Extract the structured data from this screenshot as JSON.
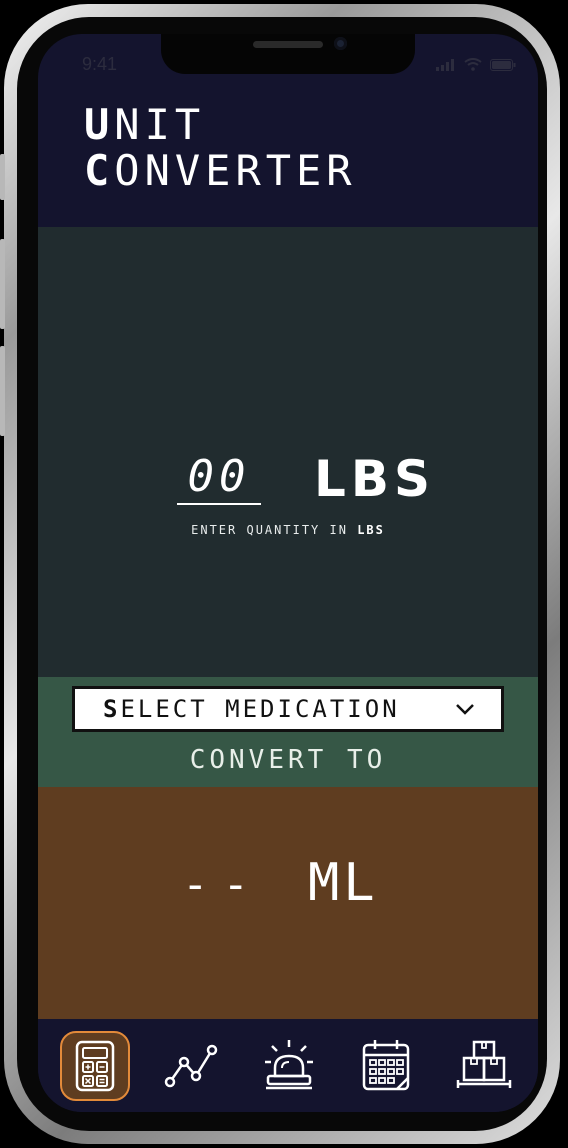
{
  "status_bar": {
    "time": "9:41"
  },
  "header": {
    "title_line1_first": "U",
    "title_line1_rest": "NIT",
    "title_line2_first": "C",
    "title_line2_rest": "ONVERTER"
  },
  "input": {
    "quantity": "00",
    "unit": "LBS",
    "hint_prefix": "ENTER QUANTITY IN",
    "hint_unit": "LBS"
  },
  "select": {
    "label_first": "S",
    "label_rest": "ELECT MEDICATION"
  },
  "convert_label": "CONVERT TO",
  "result": {
    "value": "--",
    "unit": "ML"
  },
  "tabs": [
    {
      "icon": "calculator-icon",
      "active": true
    },
    {
      "icon": "line-chart-icon",
      "active": false
    },
    {
      "icon": "siren-icon",
      "active": false
    },
    {
      "icon": "calendar-icon",
      "active": false
    },
    {
      "icon": "boxes-icon",
      "active": false
    }
  ],
  "colors": {
    "header_bg": "#14142e",
    "input_bg": "#212c2f",
    "select_bg": "#365746",
    "result_bg": "#5f3d20",
    "active_tab_border": "#e28a3a"
  }
}
